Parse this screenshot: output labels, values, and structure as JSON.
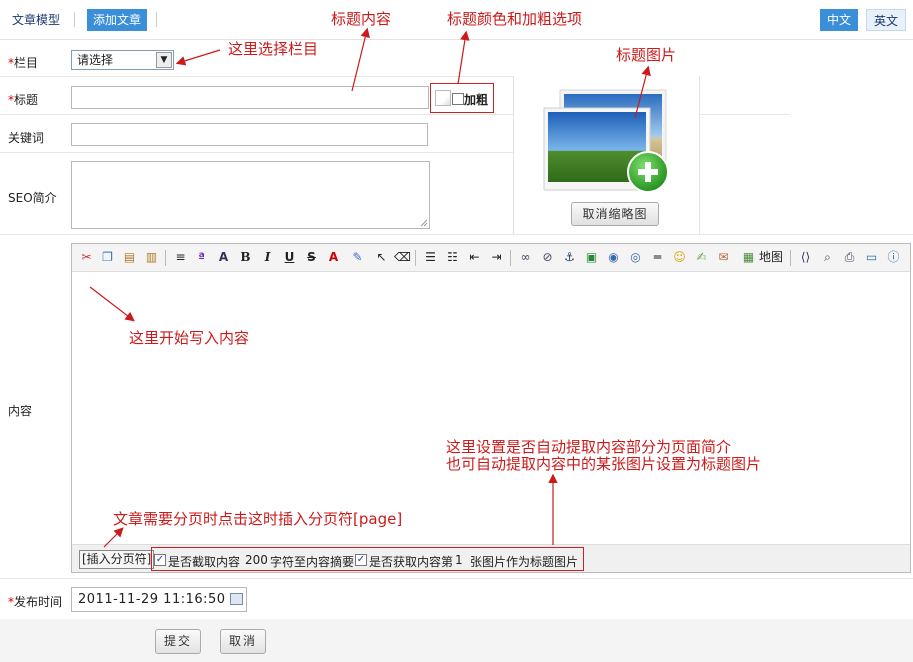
{
  "topbar": {
    "tabs": [
      {
        "label": "文章模型"
      },
      {
        "label": "添加文章"
      }
    ],
    "lang": {
      "zh": "中文",
      "en": "英文"
    }
  },
  "form": {
    "category": {
      "label": "栏目",
      "required_mark": "*",
      "value": "请选择"
    },
    "title": {
      "label": "标题",
      "required_mark": "*",
      "value": "",
      "bold_label": "加粗"
    },
    "keywords": {
      "label": "关键词",
      "value": ""
    },
    "seo": {
      "label": "SEO简介",
      "value": ""
    },
    "thumb": {
      "cancel_label": "取消缩略图"
    },
    "content": {
      "label": "内容"
    },
    "publish": {
      "label": "发布时间",
      "required_mark": "*",
      "value": "2011-11-29 11:16:50"
    }
  },
  "editor": {
    "toolbar_map_label": "地图",
    "footer": {
      "page_break": "[插入分页符]",
      "opt1_before": "是否截取内容",
      "opt1_count": "200",
      "opt1_after": "字符至内容摘要",
      "opt2_before": "是否获取内容第",
      "opt2_count": "1",
      "opt2_after": "张图片作为标题图片",
      "opt1_checked": true,
      "opt2_checked": true
    }
  },
  "buttons": {
    "submit": "提交",
    "cancel": "取消"
  },
  "annotations": {
    "title_content": "标题内容",
    "title_color_bold": "标题颜色和加粗选项",
    "choose_category": "这里选择栏目",
    "title_image": "标题图片",
    "start_writing": "这里开始写入内容",
    "auto_extract_1": "这里设置是否自动提取内容部分为页面简介",
    "auto_extract_2": "也可自动提取内容中的某张图片设置为标题图片",
    "page_break_hint": "文章需要分页时点击这时插入分页符[page]"
  },
  "colors": {
    "accent": "#3b8fd8",
    "annotation": "#cc1a1a",
    "required": "#d40000"
  }
}
